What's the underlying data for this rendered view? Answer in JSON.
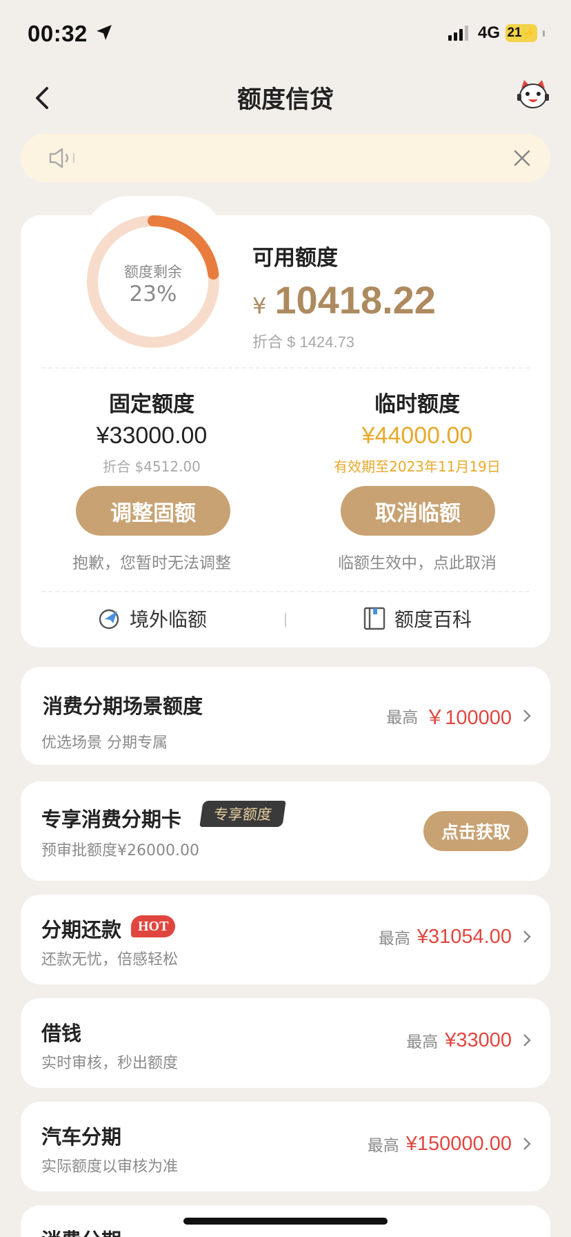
{
  "status": {
    "time": "00:32",
    "network": "4G",
    "battery": "21"
  },
  "nav": {
    "title": "额度信贷"
  },
  "notice": {
    "text": ""
  },
  "credit": {
    "remaining_label": "额度剩余",
    "remaining_pct": "23%",
    "remaining_fraction": 0.23,
    "available_title": "可用额度",
    "currency": "¥",
    "available_amount": "10418.22",
    "available_usd": "折合 $ 1424.73",
    "fixed": {
      "title": "固定额度",
      "amount": "¥33000.00",
      "sub": "折合 $4512.00",
      "button": "调整固额",
      "note": "抱歉，您暂时无法调整"
    },
    "temp": {
      "title": "临时额度",
      "amount": "¥44000.00",
      "sub": "有效期至2023年11月19日",
      "button": "取消临额",
      "note": "临额生效中，点此取消"
    },
    "links": {
      "overseas": "境外临额",
      "wiki": "额度百科"
    }
  },
  "rows": {
    "scene": {
      "title": "消费分期场景额度",
      "sub": "优选场景 分期专属",
      "label": "最高",
      "value": "￥100000"
    },
    "card": {
      "title": "专享消费分期卡",
      "tag": "专享额度",
      "sub": "预审批额度¥26000.00",
      "button": "点击获取"
    },
    "repay": {
      "title": "分期还款",
      "tag": "HOT",
      "sub": "还款无忧，倍感轻松",
      "label": "最高",
      "value": "¥31054.00"
    },
    "borrow": {
      "title": "借钱",
      "sub": "实时审核，秒出额度",
      "label": "最高",
      "value": "¥33000"
    },
    "car": {
      "title": "汽车分期",
      "sub": "实际额度以审核为准",
      "label": "最高",
      "value": "¥150000.00"
    },
    "consume": {
      "title": "消费分期"
    }
  },
  "colors": {
    "accent": "#c8a273",
    "amount_gold": "#ad8a5f",
    "orange": "#e87c3e",
    "orange_light": "#f7dccb",
    "red": "#e0463f",
    "temp_gold": "#e8a92a"
  }
}
